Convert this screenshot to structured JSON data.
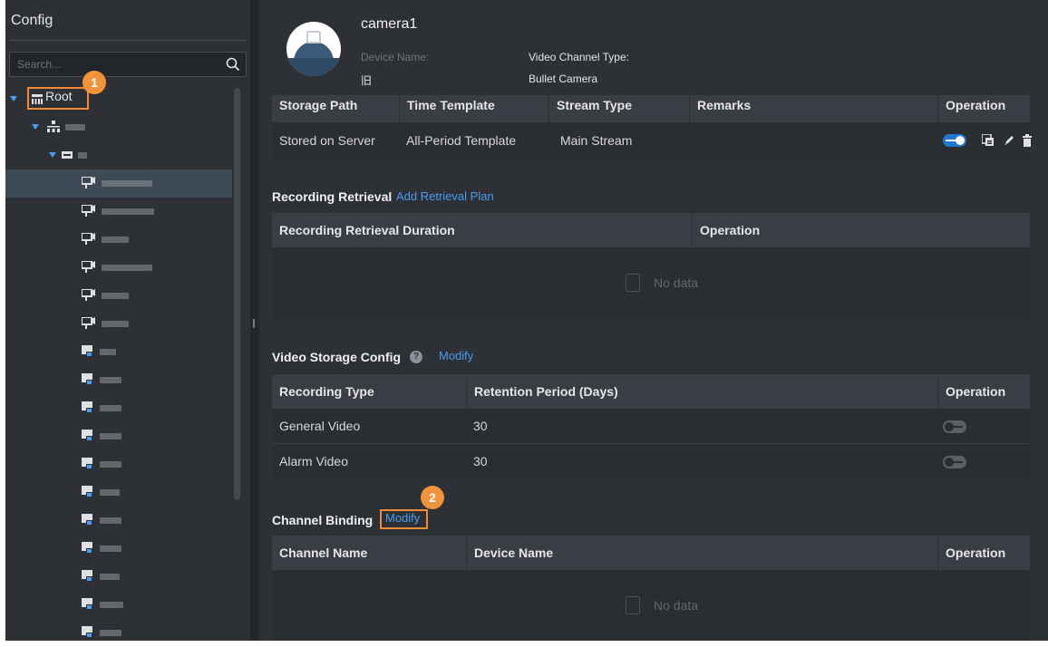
{
  "sidebar": {
    "title": "Config",
    "search_placeholder": "Search...",
    "root_label": "Root",
    "badge_1": "1"
  },
  "header": {
    "camera_name": "camera1",
    "device_name_label": "Device Name:",
    "device_name_value": "旧",
    "video_channel_type_label": "Video Channel Type:",
    "video_channel_type_value": "Bullet Camera"
  },
  "storage_plan": {
    "columns": [
      "Storage Path",
      "Time Template",
      "Stream Type",
      "Remarks",
      "Operation"
    ],
    "row": {
      "storage_path": "Stored on Server",
      "time_template": "All-Period Template",
      "stream_type": "Main Stream",
      "enabled": true
    }
  },
  "recording_retrieval": {
    "title": "Recording Retrieval",
    "add_link": "Add Retrieval Plan",
    "columns": [
      "Recording Retrieval Duration",
      "Operation"
    ],
    "empty_text": "No data"
  },
  "video_storage": {
    "title": "Video Storage Config",
    "modify_link": "Modify",
    "columns": [
      "Recording Type",
      "Retention Period (Days)",
      "Operation"
    ],
    "rows": [
      {
        "type": "General Video",
        "days": "30",
        "enabled": false
      },
      {
        "type": "Alarm Video",
        "days": "30",
        "enabled": false
      }
    ]
  },
  "channel_binding": {
    "title": "Channel Binding",
    "modify_link": "Modify",
    "badge_2": "2",
    "columns": [
      "Channel Name",
      "Device Name",
      "Operation"
    ],
    "empty_text": "No data"
  },
  "colors": {
    "accent": "#4a9cf0",
    "highlight": "#ec8b3a",
    "background": "#2d3034"
  }
}
